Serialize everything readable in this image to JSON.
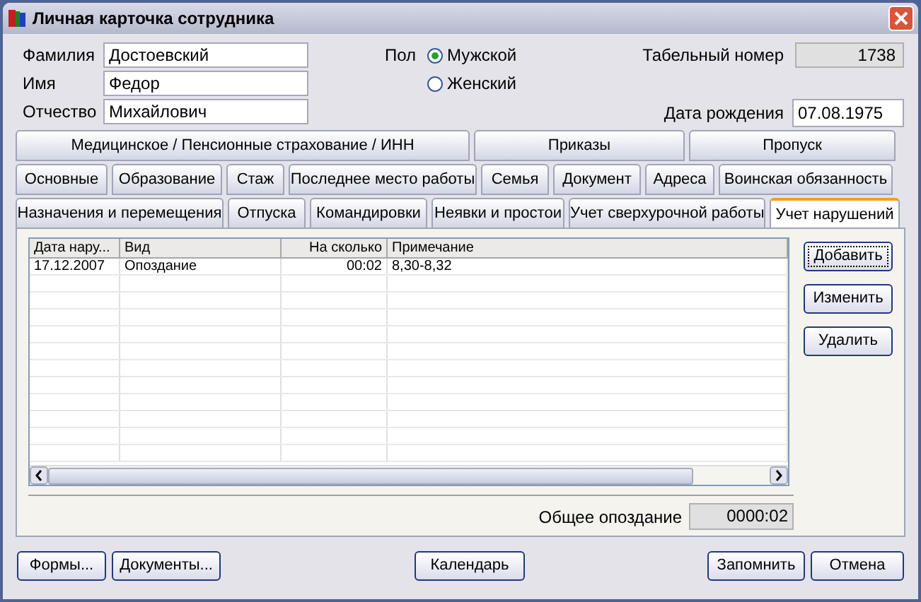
{
  "window": {
    "title": "Личная карточка сотрудника"
  },
  "fields": [
    {
      "label": "Фамилия",
      "value": "Достоевский"
    },
    {
      "label": "Имя",
      "value": "Федор"
    },
    {
      "label": "Отчество",
      "value": "Михайлович"
    }
  ],
  "gender": {
    "label": "Пол",
    "options": [
      {
        "label": "Мужской",
        "selected": true
      },
      {
        "label": "Женский",
        "selected": false
      }
    ]
  },
  "personnel_number": {
    "label": "Табельный номер",
    "value": "1738"
  },
  "birth_date": {
    "label": "Дата рождения",
    "value": "07.08.1975"
  },
  "tab_rows": [
    [
      {
        "label": "Медицинское / Пенсионные страхование / ИНН",
        "selected": false
      },
      {
        "label": "Приказы",
        "selected": false
      },
      {
        "label": "Пропуск",
        "selected": false
      }
    ],
    [
      {
        "label": "Основные",
        "selected": false
      },
      {
        "label": "Образование",
        "selected": false
      },
      {
        "label": "Стаж",
        "selected": false
      },
      {
        "label": "Последнее место работы",
        "selected": false
      },
      {
        "label": "Семья",
        "selected": false
      },
      {
        "label": "Документ",
        "selected": false
      },
      {
        "label": "Адреса",
        "selected": false
      },
      {
        "label": "Воинская обязанность",
        "selected": false
      }
    ],
    [
      {
        "label": "Назначения и перемещения",
        "selected": false
      },
      {
        "label": "Отпуска",
        "selected": false
      },
      {
        "label": "Командировки",
        "selected": false
      },
      {
        "label": "Неявки и простои",
        "selected": false
      },
      {
        "label": "Учет сверхурочной работы",
        "selected": false
      },
      {
        "label": "Учет нарушений",
        "selected": true
      }
    ]
  ],
  "table": {
    "columns": [
      "Дата нару...",
      "Вид",
      "На сколько",
      "Примечание"
    ],
    "rows": [
      [
        "17.12.2007",
        "Опоздание",
        "00:02",
        "8,30-8,32"
      ]
    ]
  },
  "side_buttons": [
    "Добавить",
    "Изменить",
    "Удалить"
  ],
  "total": {
    "label": "Общее опоздание",
    "value": "0000:02"
  },
  "footer_left": [
    "Формы...",
    "Документы..."
  ],
  "footer_center": [
    "Календарь"
  ],
  "footer_right": [
    "Запомнить",
    "Отмена"
  ]
}
